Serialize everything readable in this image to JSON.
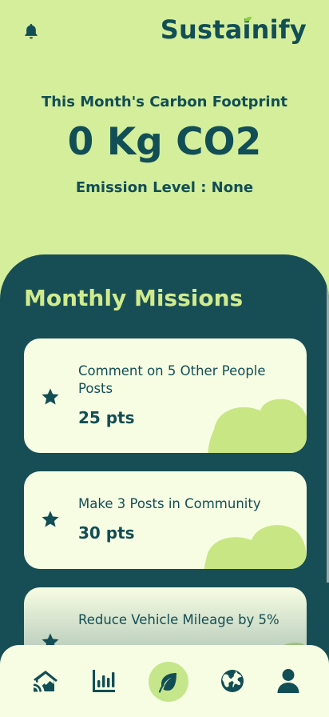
{
  "app": {
    "brand": {
      "before_i": "Susta",
      "i_letter": "i",
      "after_i": "nify"
    }
  },
  "hero": {
    "subtitle": "This Month's Carbon Footprint",
    "value": "0 Kg CO2",
    "emission_level": "Emission Level : None"
  },
  "missions": {
    "title": "Monthly Missions",
    "items": [
      {
        "label": "Comment on 5 Other People Posts",
        "points": "25 pts"
      },
      {
        "label": "Make 3 Posts in Community",
        "points": "30 pts"
      },
      {
        "label": "Reduce Vehicle Mileage by 5%",
        "points": ""
      }
    ]
  },
  "nav": {
    "items": [
      {
        "icon": "home-icon"
      },
      {
        "icon": "chart-icon"
      },
      {
        "icon": "leaf-icon",
        "active": true
      },
      {
        "icon": "globe-icon"
      },
      {
        "icon": "profile-icon"
      }
    ]
  },
  "colors": {
    "background": "#d4ee9c",
    "panel": "#174e55",
    "card": "#f7fde3",
    "accent": "#c5e68a",
    "text_dark": "#124e55",
    "title_light": "#d0eb8e"
  }
}
